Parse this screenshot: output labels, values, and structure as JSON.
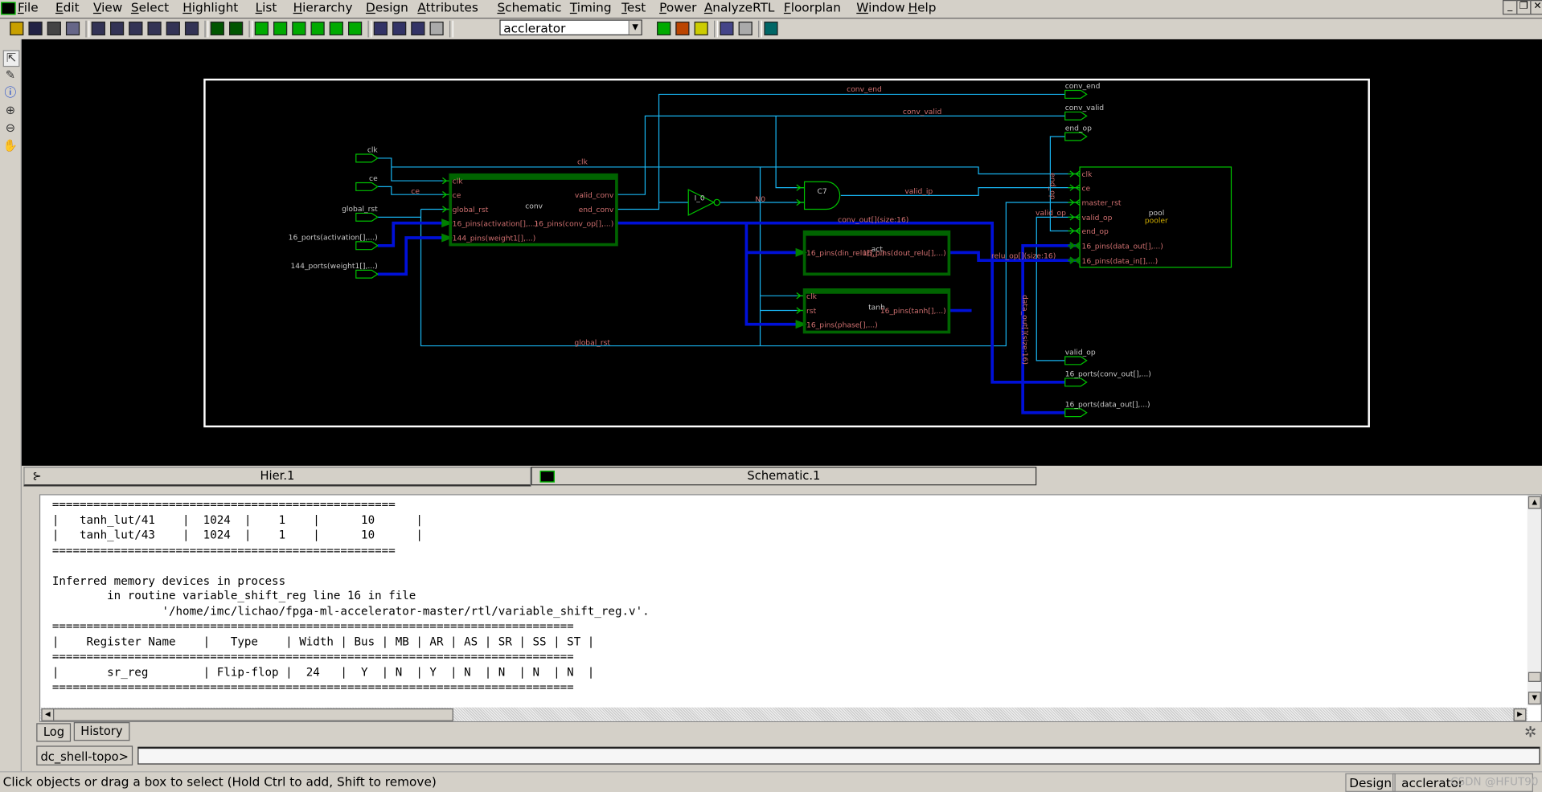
{
  "app": {
    "menus": [
      "File",
      "Edit",
      "View",
      "Select",
      "Highlight",
      "List",
      "Hierarchy",
      "Design",
      "Attributes",
      "Schematic",
      "Timing",
      "Test",
      "Power",
      "AnalyzeRTL",
      "Floorplan",
      "Window",
      "Help"
    ]
  },
  "toolbar": {
    "icons": [
      "open-folder-icon",
      "save-icon",
      "print-icon",
      "properties-icon",
      "zoom-fit-icon",
      "zoom-2-icon",
      "zoom-half-icon",
      "zoom-previous-icon",
      "zoom-selection-icon",
      "zoom-box-icon",
      "push-down-icon",
      "pop-up-icon",
      "schematic-icon",
      "create-symbol-icon",
      "hierarchy-view-icon",
      "cell-view-icon",
      "path-schematic-icon",
      "timing-path-icon",
      "histogram-icon",
      "histogram-endpoint-icon",
      "histogram-bar-icon",
      "disabled-icon",
      "report-icon",
      "table-icon",
      "check-icon",
      "back-icon",
      "forward-icon",
      "layout-icon"
    ],
    "design_select": "acclerator"
  },
  "left_tools": [
    "select-arrow-icon",
    "pencil-icon",
    "info-icon",
    "zoom-in-icon",
    "zoom-out-icon",
    "pan-hand-icon"
  ],
  "schematic": {
    "in_ports": [
      "clk",
      "ce",
      "global_rst",
      "16_ports(activation[],...)",
      "144_ports(weight1[],...)"
    ],
    "out_ports": [
      "conv_end",
      "conv_valid",
      "end_op",
      "valid_op",
      "16_ports(conv_out[],...)",
      "16_ports(data_out[],...)"
    ],
    "conv": {
      "name": "conv",
      "left_pins": [
        "clk",
        "ce",
        "global_rst",
        "16_pins(activation[],...)",
        "144_pins(weight1[],...)"
      ],
      "right_pins": [
        "valid_conv",
        "end_conv",
        "16_pins(conv_op[],...)"
      ]
    },
    "act": {
      "name": "act",
      "left_pin": "16_pins(din_relu[],...)",
      "right_pin": "16_pins(dout_relu[],...)"
    },
    "tanh": {
      "name": "tanh",
      "left_pins": [
        "clk",
        "rst",
        "16_pins(phase[],...)"
      ],
      "right_pin": "16_pins(tanh[],...)"
    },
    "pool": {
      "name": "pool",
      "ref": "pooler",
      "pins": [
        "clk",
        "ce",
        "master_rst",
        "valid_op",
        "end_op",
        "16_pins(data_out[],...)",
        "16_pins(data_in[],...)"
      ]
    },
    "inverter": "I_0",
    "and_gate": "C7",
    "nets": {
      "clk": "clk",
      "ce": "ce",
      "conv_end": "conv_end",
      "conv_valid": "conv_valid",
      "n0": "N0",
      "valid_ip": "valid_ip",
      "conv_out": "conv_out[](size:16)",
      "relu_op": "relu_op[](size:16)",
      "data_out": "data_out[](size:16)",
      "valid_op": "valid_op",
      "end_op": "end_op",
      "global_rst": "global_rst"
    },
    "colors": {
      "background": "#000000",
      "wire": "#18b4f0",
      "bus": "#0010d8",
      "cell": "#006400",
      "pin_label": "#d07070"
    }
  },
  "tabs": [
    {
      "label": "Hier.1"
    },
    {
      "label": "Schematic.1",
      "active": true
    }
  ],
  "console": {
    "lines": [
      "==================================================",
      "|   tanh_lut/41    |  1024  |    1    |      10      |",
      "|   tanh_lut/43    |  1024  |    1    |      10      |",
      "==================================================",
      "",
      "Inferred memory devices in process",
      "        in routine variable_shift_reg line 16 in file",
      "                '/home/imc/lichao/fpga-ml-accelerator-master/rtl/variable_shift_reg.v'.",
      "============================================================================",
      "|    Register Name    |   Type    | Width | Bus | MB | AR | AS | SR | SS | ST |",
      "============================================================================",
      "|       sr_reg        | Flip-flop |  24   |  Y  | N  | Y  | N  | N  | N  | N  |",
      "============================================================================"
    ]
  },
  "console_tabs": [
    "Log",
    "History"
  ],
  "prompt": {
    "label": "dc_shell-topo>",
    "value": ""
  },
  "status": {
    "message": "Click objects or drag a box to select (Hold Ctrl to add, Shift to remove)",
    "design_label": "Design",
    "design_value": "acclerator",
    "watermark": "CSDN @HFUT90"
  }
}
